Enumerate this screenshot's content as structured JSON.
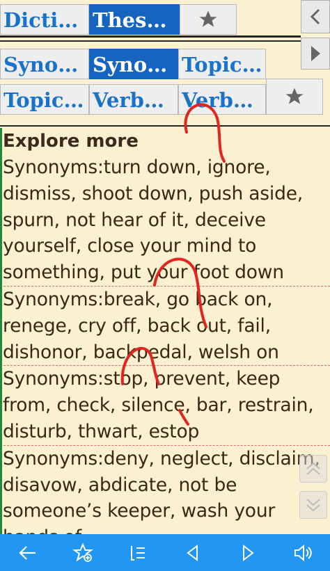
{
  "tabs_row1": [
    {
      "label": "Dicti…",
      "active": false
    },
    {
      "label": "Thes…",
      "active": true
    }
  ],
  "tabs_row2": [
    {
      "label": "Syno…",
      "active": false
    },
    {
      "label": "Syno…",
      "active": true
    },
    {
      "label": "Topic…",
      "active": false
    }
  ],
  "tabs_row3": [
    {
      "label": "Topic…",
      "active": false
    },
    {
      "label": "Verb…",
      "active": false
    },
    {
      "label": "Verb…",
      "active": false
    }
  ],
  "content": {
    "heading": "Explore more",
    "entries": [
      "Synonyms:turn down, ignore, dismiss, shoot down, push aside, spurn, not hear of it, deceive yourself, close your mind to something, put your foot down",
      "Synonyms:break, go back on, renege, cry off, back out, fail, dishonor, backpedal, welsh on",
      "Synonyms:stop, prevent, keep from, check, silence, bar, restrain, disturb, thwart, estop",
      "Synonyms:deny, neglect, disclaim, disavow, abdicate, not be someone’s keeper, wash your hands of"
    ]
  },
  "colors": {
    "background": "#fbf0cf",
    "tab_active": "#1565c0",
    "tab_text": "#1a73c9",
    "bottom_bar": "#2196f3",
    "divider": "#e06a6a",
    "ink": "#e0261e"
  },
  "icons": {
    "row1_star": "star-icon",
    "row3_star": "star-icon",
    "bottom": [
      "back-arrow-icon",
      "star-add-icon",
      "list-icon",
      "prev-triangle-icon",
      "next-triangle-icon",
      "speaker-icon"
    ]
  }
}
